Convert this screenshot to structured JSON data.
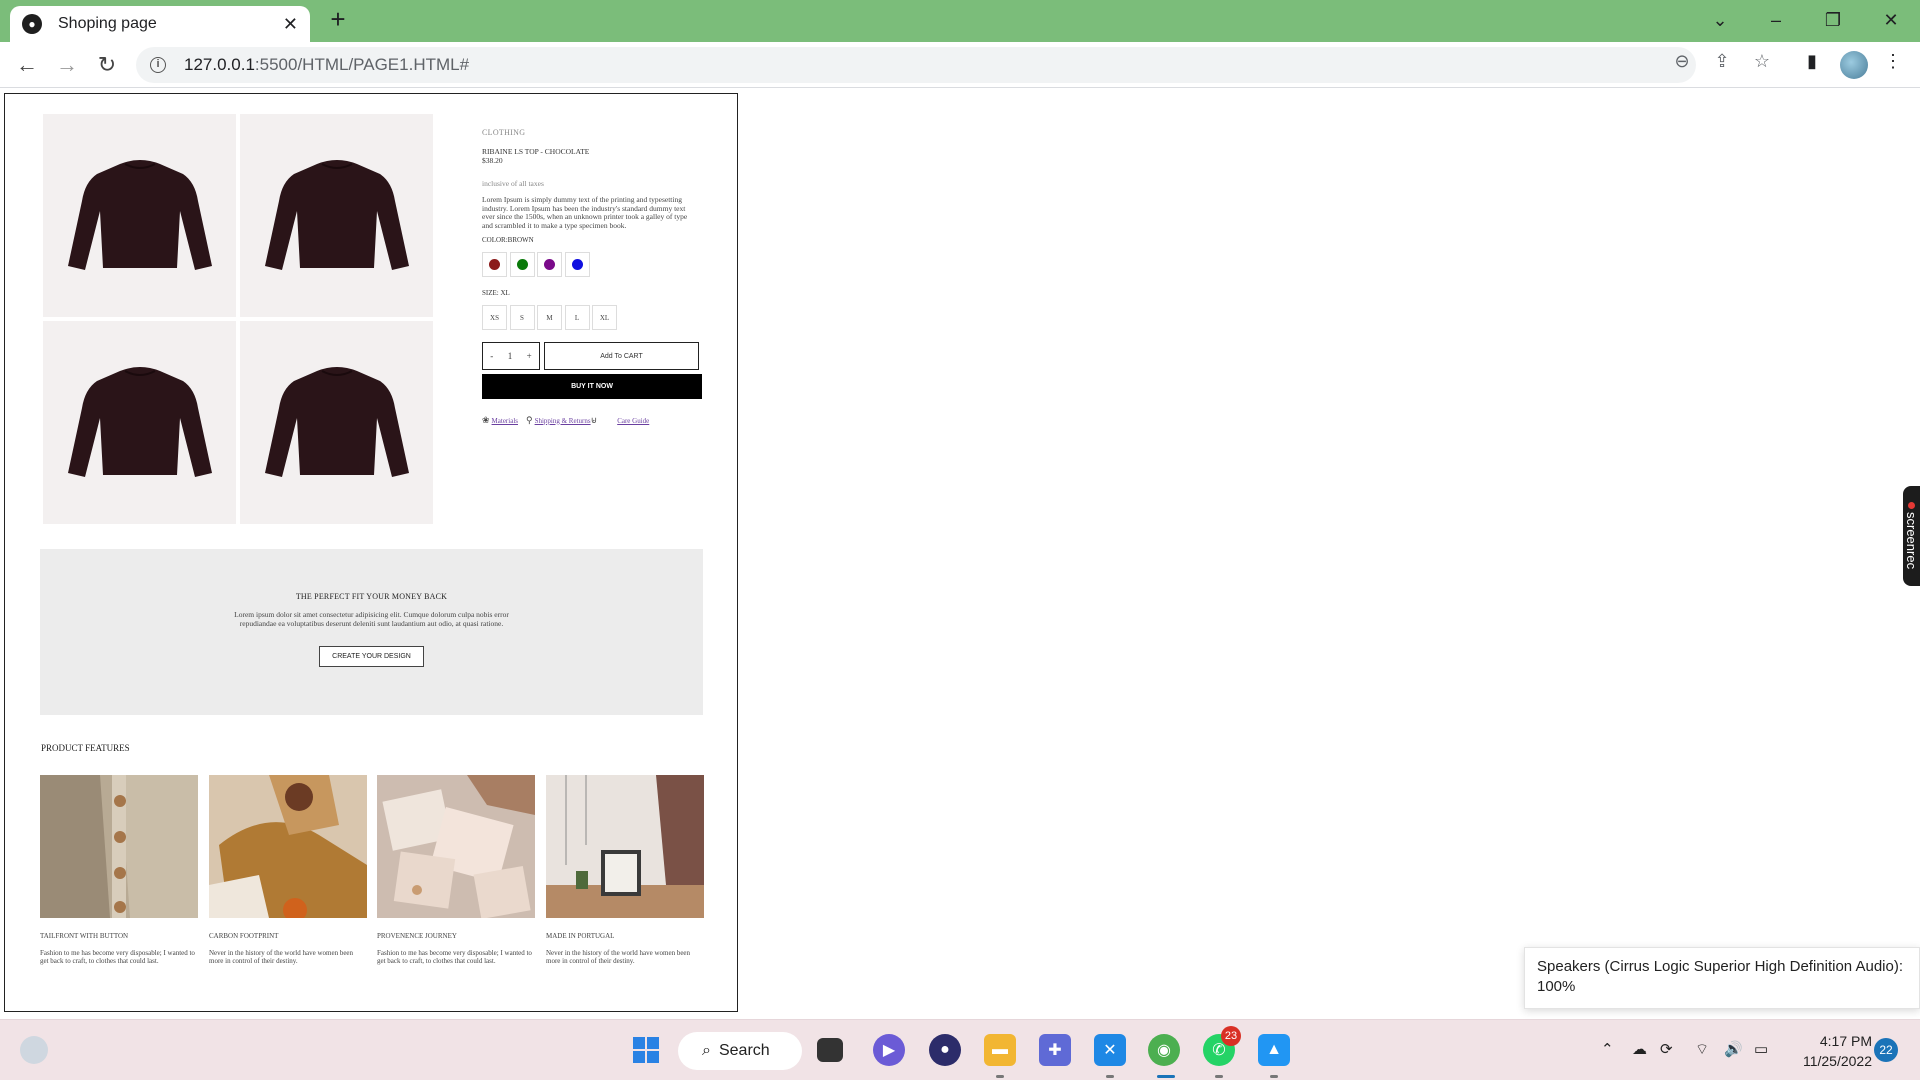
{
  "browser": {
    "tab_title": "Shoping page",
    "new_tab": "+",
    "close_tab": "✕",
    "url_host": "127.0.0.1",
    "url_path": ":5500/HTML/PAGE1.HTML#"
  },
  "product": {
    "category": "CLOTHING",
    "name": "RIBAINE LS TOP - CHOCOLATE",
    "price": "$38.20",
    "tax_note": "inclusive of all taxes",
    "description": "Lorem Ipsum is simply dummy text of the printing and typesetting industry. Lorem Ipsum has been the industry's standard dummy text ever since the 1500s, when an unknown printer took a galley of type and scrambled it to make a type specimen book.",
    "color_label": "COLOR:BROWN",
    "swatches": [
      "#8b1a1a",
      "#0a7a0a",
      "#7a0a8a",
      "#1010e0"
    ],
    "size_label": "SIZE: XL",
    "sizes": [
      "XS",
      "S",
      "M",
      "L",
      "XL"
    ],
    "qty_minus": "-",
    "qty_value": "1",
    "qty_plus": "+",
    "add_to_cart": "Add To CART",
    "buy_now": "BUY IT NOW",
    "links": {
      "materials": "Materials",
      "shipping": "Shipping & Returns",
      "care": "Care Guide"
    }
  },
  "banner": {
    "title": "THE PERFECT FIT YOUR MONEY BACK",
    "text": "Lorem ipsum dolor sit amet consectetur adipisicing elit. Cumque dolorum culpa nobis error repudiandae ea voluptatibus deserunt deleniti sunt laudantium aut odio, at quasi ratione.",
    "button": "CREATE YOUR DESIGN"
  },
  "features": {
    "heading": "PRODUCT FEATURES",
    "items": [
      {
        "title": "TAILFRONT WITH BUTTON",
        "text": "Fashion to me has become very disposable; I wanted to get back to craft, to clothes that could last."
      },
      {
        "title": "CARBON FOOTPRINT",
        "text": "Never in the history of the world have women been more in control of their destiny."
      },
      {
        "title": "PROVENENCE JOURNEY",
        "text": "Fashion to me has become very disposable; I wanted to get back to craft, to clothes that could last."
      },
      {
        "title": "MADE IN PORTUGAL",
        "text": "Never in the history of the world have women been more in control of their destiny."
      }
    ]
  },
  "overlay": {
    "screenrec": "screenrec",
    "toast": "Speakers (Cirrus Logic Superior High Definition Audio): 100%"
  },
  "taskbar": {
    "search": "Search",
    "whatsapp_badge": "23",
    "time": "4:17 PM",
    "date": "11/25/2022",
    "notifications": "22"
  }
}
